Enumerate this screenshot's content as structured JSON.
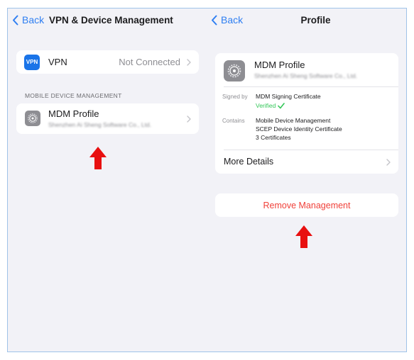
{
  "left_panel": {
    "back_label": "Back",
    "title": "VPN & Device Management",
    "vpn": {
      "icon_text": "VPN",
      "label": "VPN",
      "status": "Not Connected"
    },
    "section_header": "MOBILE DEVICE MANAGEMENT",
    "mdm": {
      "title": "MDM Profile",
      "subtitle": "Shenzhen Ai Sheng Software Co., Ltd."
    }
  },
  "right_panel": {
    "back_label": "Back",
    "title": "Profile",
    "profile": {
      "title": "MDM Profile",
      "subtitle": "Shenzhen Ai Sheng Software Co., Ltd.",
      "signed_by_label": "Signed by",
      "signed_by_value": "MDM Signing Certificate",
      "verified": "Verified",
      "contains_label": "Contains",
      "contains_1": "Mobile Device Management",
      "contains_2": "SCEP Device Identity Certificate",
      "contains_3": "3 Certificates",
      "more_details": "More Details"
    },
    "remove_label": "Remove Management"
  },
  "colors": {
    "background": "#f2f2f7",
    "accent": "#2f7ff2",
    "destructive": "#f0413a",
    "verified": "#34c759",
    "annotation_arrow": "#e81010"
  },
  "icons": [
    "chevron-left-icon",
    "chevron-right-icon",
    "gear-icon",
    "checkmark-icon",
    "up-arrow-icon"
  ]
}
